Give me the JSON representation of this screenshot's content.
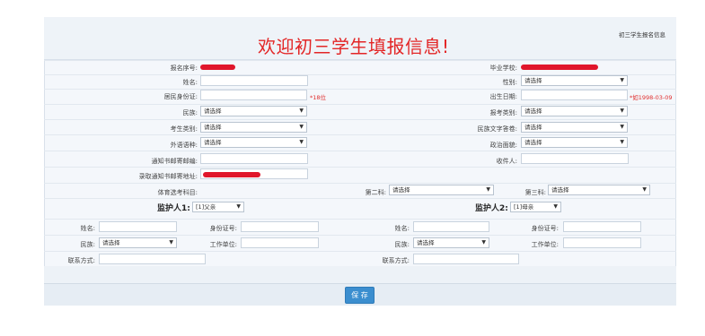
{
  "header": {
    "title": "欢迎初三学生填报信息!",
    "corner_text": "初三学生报名信息"
  },
  "form": {
    "reg_no_label": "报名序号:",
    "school_label": "毕业学校:",
    "name_label": "姓名:",
    "gender_label": "性别:",
    "gender_value": "请选择",
    "id_label": "居民身份证:",
    "id_hint": "*18位",
    "birth_label": "出生日期:",
    "birth_hint": "*如1998-03-09",
    "ethnic_label": "民族:",
    "ethnic_value": "请选择",
    "exam_type_label": "报考类别:",
    "exam_type_value": "请选择",
    "candidate_label": "考生类别:",
    "candidate_value": "请选择",
    "ethnic_lang_label": "民族文字答卷:",
    "ethnic_lang_value": "请选择",
    "foreign_label": "外语语种:",
    "foreign_value": "请选择",
    "political_label": "政治面貌:",
    "political_value": "请选择",
    "postcode_label": "通知书邮寄邮编:",
    "recipient_label": "收件人:",
    "address_label": "录取通知书邮寄地址:",
    "pe_label": "体育选考科目:",
    "pe2_label": "第二科:",
    "pe2_value": "请选择",
    "pe3_label": "第三科:",
    "pe3_value": "请选择"
  },
  "guardians": {
    "g1_label": "监护人1:",
    "g1_value": "[1]父亲",
    "g2_label": "监护人2:",
    "g2_value": "[1]母亲",
    "name_label": "姓名:",
    "id_label": "身份证号:",
    "ethnic_label": "民族:",
    "ethnic_value": "请选择",
    "work_label": "工作单位:",
    "contact_label": "联系方式:"
  },
  "actions": {
    "save_label": "保 存"
  },
  "colors": {
    "title_red": "#e32626",
    "button_blue": "#3b8ecf"
  },
  "icons": {
    "select_caret": "▼"
  }
}
